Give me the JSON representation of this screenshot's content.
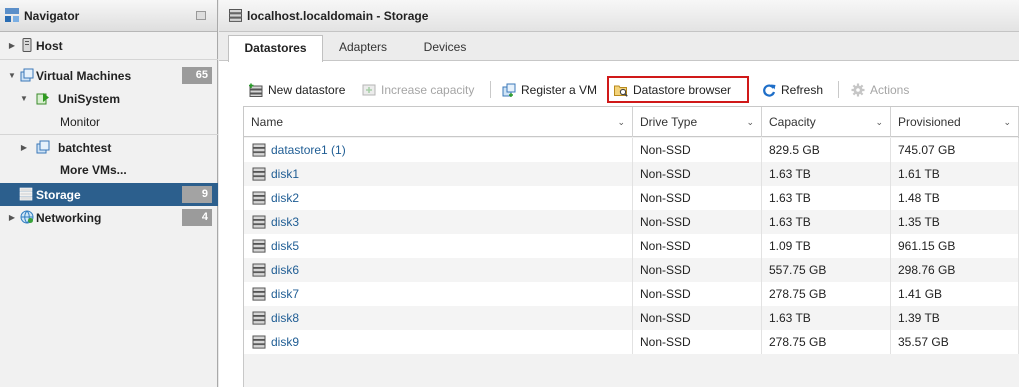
{
  "navigator": {
    "title": "Navigator",
    "items": [
      {
        "label": "Host",
        "badge": ""
      },
      {
        "label": "Virtual Machines",
        "badge": "65"
      },
      {
        "label": "UniSystem",
        "badge": ""
      },
      {
        "label": "Monitor",
        "badge": ""
      },
      {
        "label": "batchtest",
        "badge": ""
      },
      {
        "label": "More VMs...",
        "badge": ""
      },
      {
        "label": "Storage",
        "badge": "9"
      },
      {
        "label": "Networking",
        "badge": "4"
      }
    ]
  },
  "main": {
    "title": "localhost.localdomain - Storage",
    "tabs": [
      "Datastores",
      "Adapters",
      "Devices"
    ],
    "toolbar": {
      "new_datastore": "New datastore",
      "increase_capacity": "Increase capacity",
      "register_vm": "Register a VM",
      "datastore_browser": "Datastore browser",
      "refresh": "Refresh",
      "actions": "Actions"
    },
    "table": {
      "columns": [
        "Name",
        "Drive Type",
        "Capacity",
        "Provisioned"
      ],
      "rows": [
        {
          "name": "datastore1 (1)",
          "drive_type": "Non-SSD",
          "capacity": "829.5 GB",
          "provisioned": "745.07 GB"
        },
        {
          "name": "disk1",
          "drive_type": "Non-SSD",
          "capacity": "1.63 TB",
          "provisioned": "1.61 TB"
        },
        {
          "name": "disk2",
          "drive_type": "Non-SSD",
          "capacity": "1.63 TB",
          "provisioned": "1.48 TB"
        },
        {
          "name": "disk3",
          "drive_type": "Non-SSD",
          "capacity": "1.63 TB",
          "provisioned": "1.35 TB"
        },
        {
          "name": "disk5",
          "drive_type": "Non-SSD",
          "capacity": "1.09 TB",
          "provisioned": "961.15 GB"
        },
        {
          "name": "disk6",
          "drive_type": "Non-SSD",
          "capacity": "557.75 GB",
          "provisioned": "298.76 GB"
        },
        {
          "name": "disk7",
          "drive_type": "Non-SSD",
          "capacity": "278.75 GB",
          "provisioned": "1.41 GB"
        },
        {
          "name": "disk8",
          "drive_type": "Non-SSD",
          "capacity": "1.63 TB",
          "provisioned": "1.39 TB"
        },
        {
          "name": "disk9",
          "drive_type": "Non-SSD",
          "capacity": "278.75 GB",
          "provisioned": "35.57 GB"
        }
      ]
    }
  },
  "colors": {
    "selected_nav": "#2c5f8d",
    "link": "#1f5d94",
    "highlight_border": "#d01919",
    "badge": "#9b9b9b"
  },
  "icons": {
    "app": "vmware-host-client-icon",
    "host": "host-icon",
    "vm": "virtual-machines-icon",
    "vm_on": "vm-powered-on-icon",
    "storage": "storage-icon",
    "network": "networking-icon",
    "datastore": "datastore-icon",
    "refresh": "refresh-icon",
    "actions": "gear-icon"
  }
}
